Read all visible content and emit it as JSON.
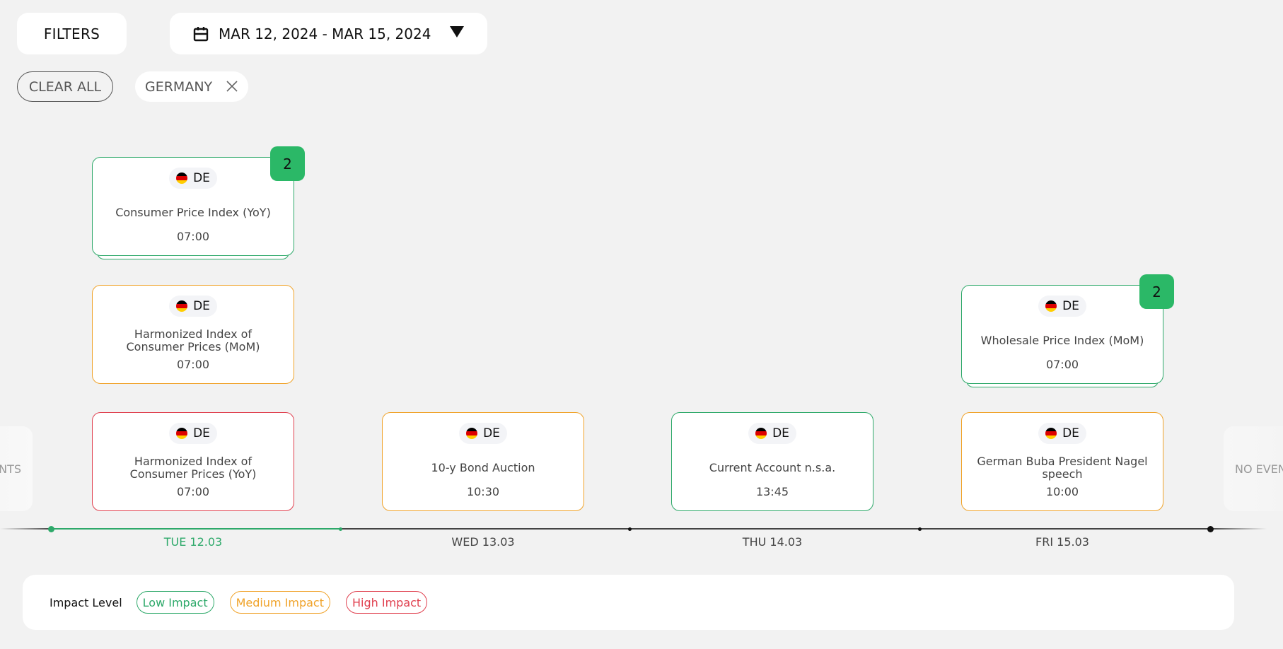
{
  "toolbar": {
    "filters_label": "FILTERS",
    "date_range": "MAR 12, 2024 - MAR 15, 2024",
    "date_icon": "calendar-icon",
    "dropdown_icon": "caret-down-icon"
  },
  "active_filters": {
    "clear_all_label": "CLEAR ALL",
    "chips": [
      {
        "label": "GERMANY",
        "remove_icon": "close-icon"
      }
    ]
  },
  "colors": {
    "low": "#2ea96a",
    "medium": "#f0a32a",
    "high": "#e0404f",
    "badge": "#2bb867",
    "flag": [
      "#000000",
      "#dd0000",
      "#ffce00"
    ]
  },
  "ghost_columns": {
    "left_text": "NO EVENTS",
    "right_text": "NO EVENTS"
  },
  "days": [
    {
      "label": "TUE 12.03",
      "active": true,
      "events": [
        {
          "country": "DE",
          "title": "Consumer Price Index (YoY)",
          "time": "07:00",
          "impact": "low",
          "count": "2"
        },
        {
          "country": "DE",
          "title": "Harmonized Index of Consumer Prices (MoM)",
          "time": "07:00",
          "impact": "medium"
        },
        {
          "country": "DE",
          "title": "Harmonized Index of Consumer Prices (YoY)",
          "time": "07:00",
          "impact": "high"
        }
      ]
    },
    {
      "label": "WED 13.03",
      "active": false,
      "events": [
        {
          "country": "DE",
          "title": "10-y Bond Auction",
          "time": "10:30",
          "impact": "medium"
        }
      ]
    },
    {
      "label": "THU 14.03",
      "active": false,
      "events": [
        {
          "country": "DE",
          "title": "Current Account n.s.a.",
          "time": "13:45",
          "impact": "low"
        }
      ]
    },
    {
      "label": "FRI 15.03",
      "active": false,
      "events": [
        {
          "country": "DE",
          "title": "Wholesale Price Index (MoM)",
          "time": "07:00",
          "impact": "low",
          "count": "2"
        },
        {
          "country": "DE",
          "title": "German Buba President Nagel speech",
          "time": "10:00",
          "impact": "medium"
        }
      ]
    }
  ],
  "legend": {
    "label": "Impact Level",
    "items": [
      {
        "key": "low",
        "label": "Low Impact"
      },
      {
        "key": "medium",
        "label": "Medium Impact"
      },
      {
        "key": "high",
        "label": "High Impact"
      }
    ]
  }
}
